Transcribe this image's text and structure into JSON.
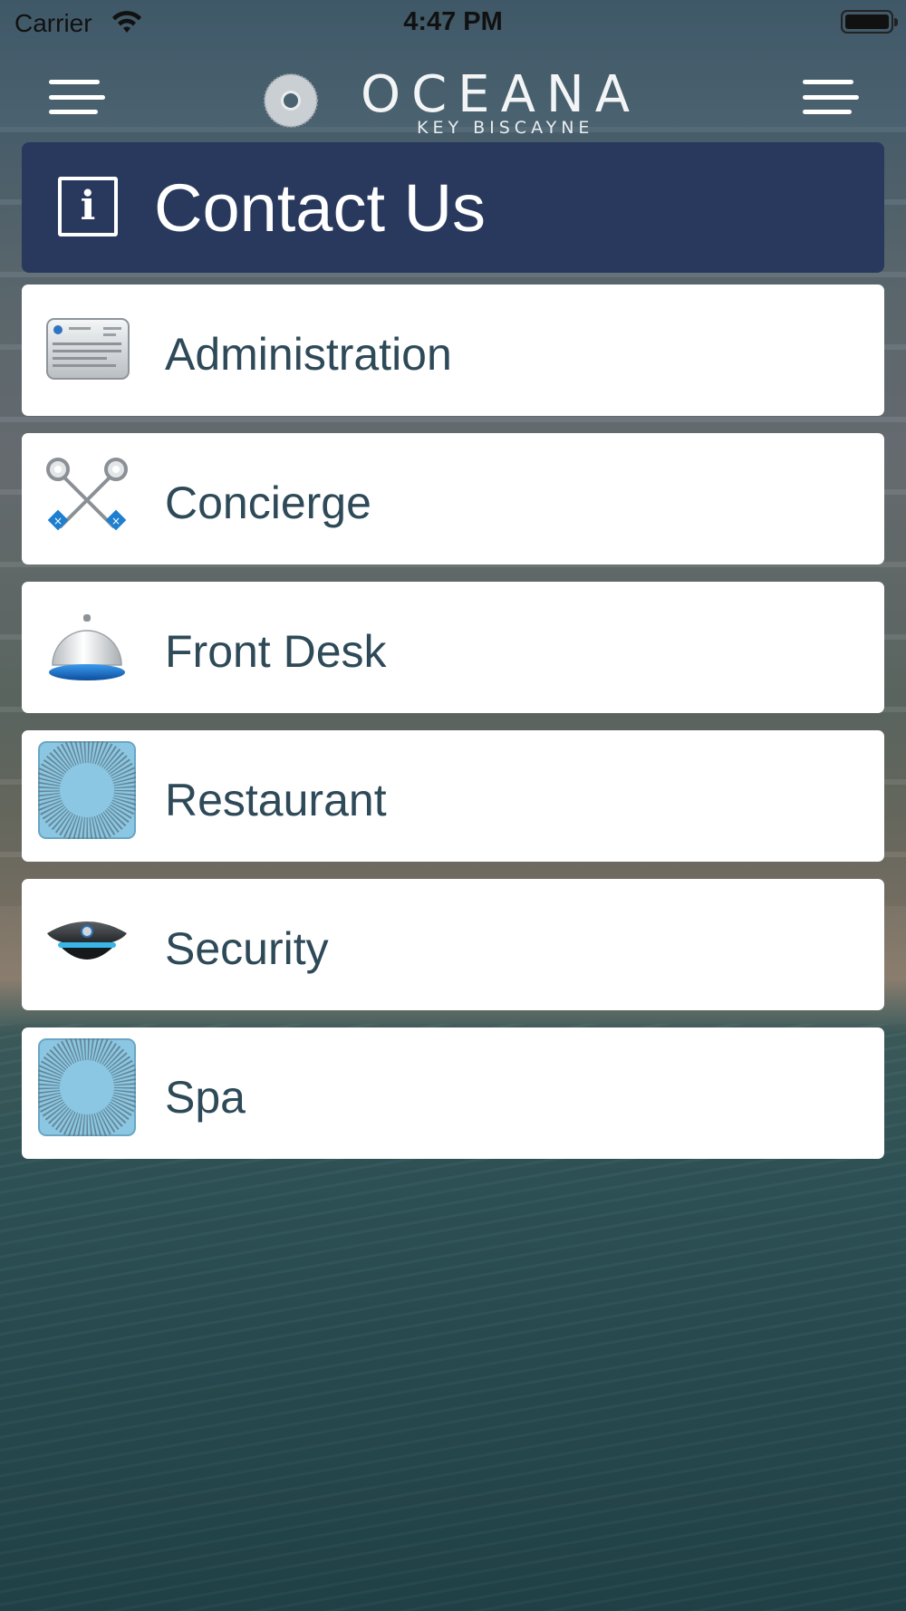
{
  "status_bar": {
    "carrier": "Carrier",
    "time": "4:47 PM"
  },
  "nav": {
    "logo_word": "OCEANA",
    "logo_sub": "KEY BISCAYNE"
  },
  "header": {
    "title": "Contact Us",
    "icon_glyph": "i"
  },
  "contacts": [
    {
      "label": "Administration",
      "icon": "id-card-icon"
    },
    {
      "label": "Concierge",
      "icon": "crossed-keys-icon"
    },
    {
      "label": "Front Desk",
      "icon": "service-bell-icon"
    },
    {
      "label": "Restaurant",
      "icon": "oceana-logo-tile-icon"
    },
    {
      "label": "Security",
      "icon": "security-cap-icon"
    },
    {
      "label": "Spa",
      "icon": "oceana-logo-tile-icon"
    }
  ],
  "colors": {
    "header_bg": "#28395d",
    "row_text": "#2e4a58",
    "tile_blue": "#8bc6e2"
  }
}
